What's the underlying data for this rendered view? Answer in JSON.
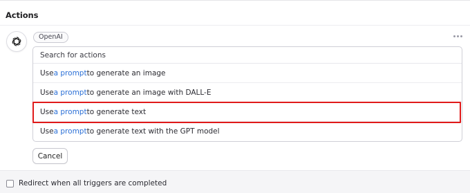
{
  "header": {
    "title": "Actions"
  },
  "provider": {
    "name": "OpenAI",
    "icon": "openai-logo-icon"
  },
  "menu": {
    "icon": "more-horizontal-icon"
  },
  "search": {
    "placeholder": "Search for actions",
    "value": ""
  },
  "options": [
    {
      "pre": "Use ",
      "link": "a prompt",
      "post": " to generate an image"
    },
    {
      "pre": "Use ",
      "link": "a prompt",
      "post": " to generate an image with DALL-E"
    },
    {
      "pre": "Use ",
      "link": "a prompt",
      "post": " to generate text",
      "highlighted": true
    },
    {
      "pre": "Use ",
      "link": "a prompt",
      "post": " to generate text with the GPT model"
    }
  ],
  "buttons": {
    "cancel": "Cancel"
  },
  "redirect": {
    "label": "Redirect when all triggers are completed",
    "checked": false
  },
  "colors": {
    "link": "#2a6fd6",
    "highlight": "#e01a1a"
  }
}
